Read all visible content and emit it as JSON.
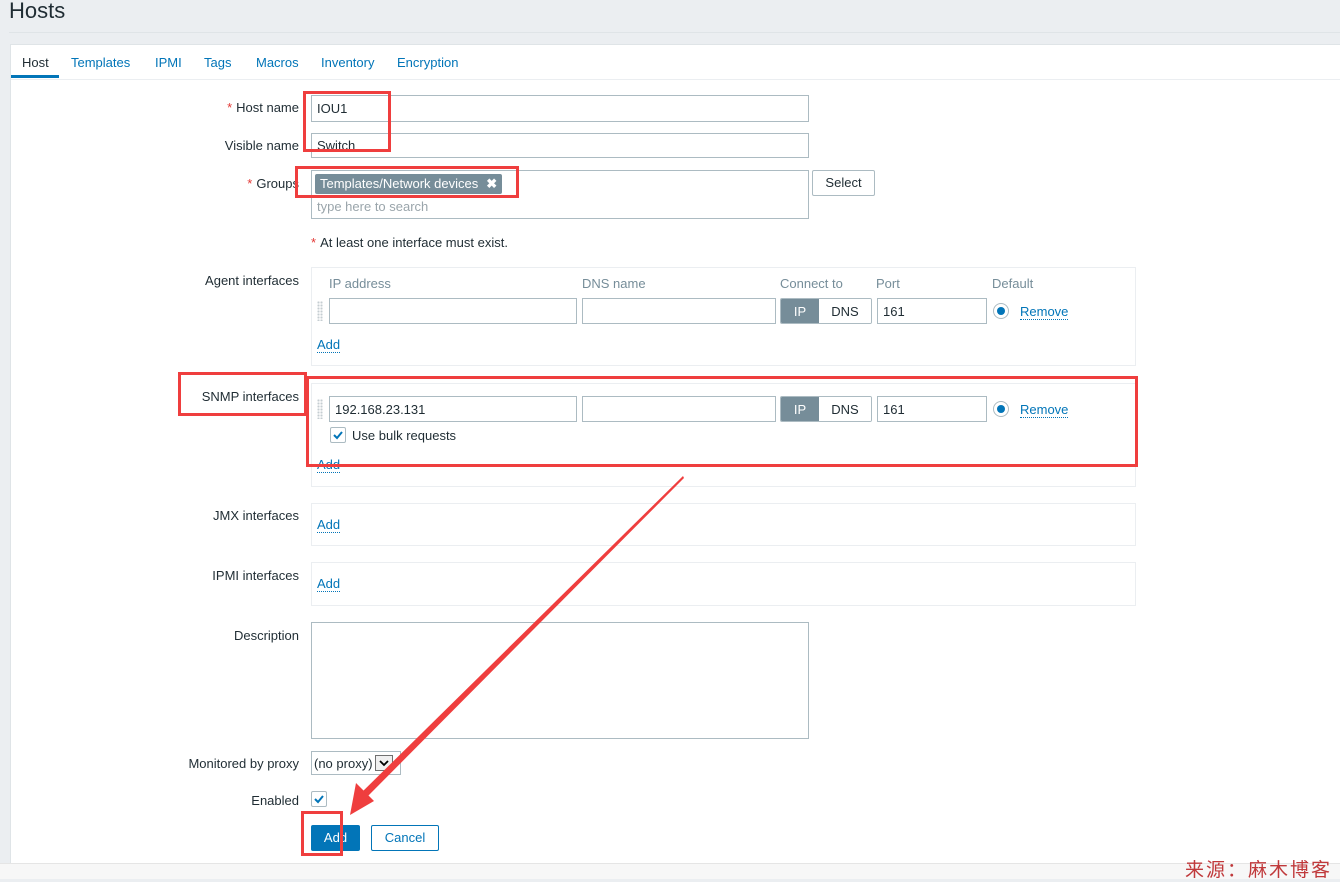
{
  "page": {
    "title": "Hosts"
  },
  "tabs": [
    {
      "label": "Host",
      "active": true
    },
    {
      "label": "Templates"
    },
    {
      "label": "IPMI"
    },
    {
      "label": "Tags"
    },
    {
      "label": "Macros"
    },
    {
      "label": "Inventory"
    },
    {
      "label": "Encryption"
    }
  ],
  "form": {
    "host_name": {
      "label": "Host name",
      "required": true,
      "value": "IOU1"
    },
    "visible_name": {
      "label": "Visible name",
      "value": "Switch"
    },
    "groups": {
      "label": "Groups",
      "required": true,
      "selected": [
        "Templates/Network devices"
      ],
      "remove_glyph": "✖",
      "placeholder": "type here to search",
      "select_label": "Select"
    },
    "interface_note": "At least one interface must exist.",
    "interface_columns": {
      "ip": "IP address",
      "dns": "DNS name",
      "connect_to": "Connect to",
      "port": "Port",
      "default": "Default"
    },
    "agent_interfaces": {
      "label": "Agent interfaces",
      "rows": [
        {
          "ip": "",
          "dns": "",
          "connect_to": "IP",
          "port": "161",
          "default": true
        }
      ],
      "add_label": "Add",
      "remove_label": "Remove"
    },
    "snmp_interfaces": {
      "label": "SNMP interfaces",
      "rows": [
        {
          "ip": "192.168.23.131",
          "dns": "",
          "connect_to": "IP",
          "port": "161",
          "default": true,
          "use_bulk_requests": true
        }
      ],
      "bulk_label": "Use bulk requests",
      "add_label": "Add",
      "remove_label": "Remove"
    },
    "jmx_interfaces": {
      "label": "JMX interfaces",
      "add_label": "Add"
    },
    "ipmi_interfaces": {
      "label": "IPMI interfaces",
      "add_label": "Add"
    },
    "connect_options": {
      "ip": "IP",
      "dns": "DNS"
    },
    "description": {
      "label": "Description",
      "value": ""
    },
    "proxy": {
      "label": "Monitored by proxy",
      "selected": "(no proxy)"
    },
    "enabled": {
      "label": "Enabled",
      "checked": true
    },
    "buttons": {
      "add": "Add",
      "cancel": "Cancel"
    }
  },
  "annotations": {
    "color": "#ef3e3e"
  },
  "watermark": "来源：麻木博客",
  "colors": {
    "accent": "#0275b8",
    "chip": "#768d99",
    "required": "#e33734"
  }
}
